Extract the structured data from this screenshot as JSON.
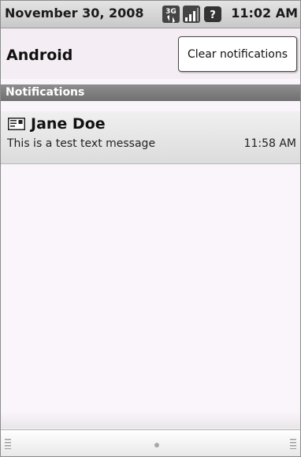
{
  "status_bar": {
    "date": "November 30, 2008",
    "time": "11:02 AM",
    "icons": [
      "3g-data-icon",
      "signal-strength-icon",
      "unknown-sim-icon"
    ]
  },
  "header": {
    "title": "Android",
    "clear_button": "Clear notifications"
  },
  "section": {
    "label": "Notifications"
  },
  "notifications": [
    {
      "icon": "sms-message-icon",
      "title": "Jane Doe",
      "text": "This is a test text message",
      "time": "11:58 AM"
    }
  ],
  "colors": {
    "section_bg": "#808080",
    "frame_bg": "#faf5fa",
    "notification_bg": "#e6e6e6"
  }
}
